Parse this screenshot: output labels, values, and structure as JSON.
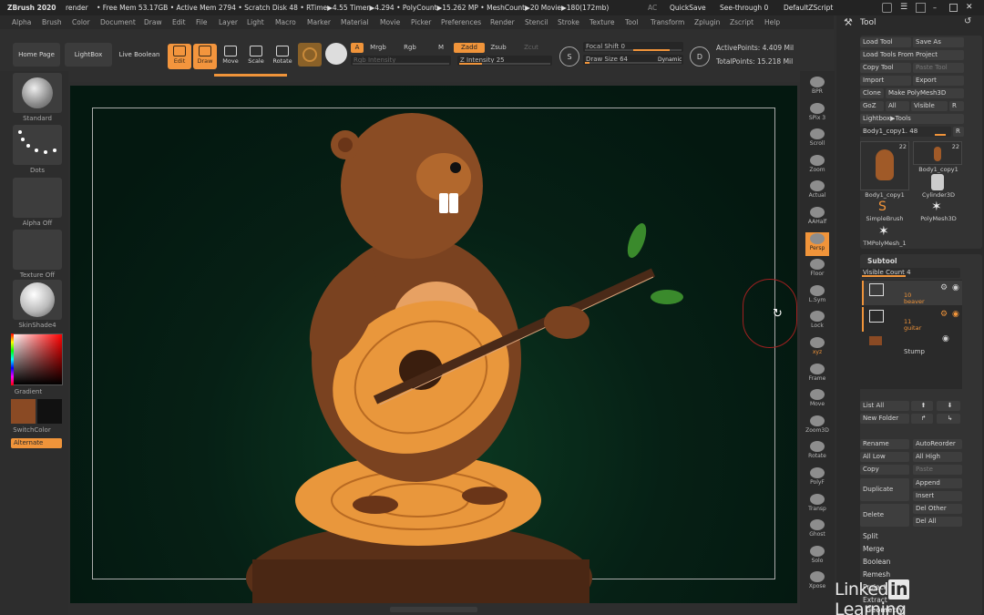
{
  "titlebar": {
    "app": "ZBrush 2020",
    "doc": "render",
    "status": "• Free Mem 53.17GB • Active Mem 2794 • Scratch Disk 48 • RTime▶4.55 Timer▶4.294 • PolyCount▶15.262 MP • MeshCount▶20  Movie▶180(172mb)",
    "ac": "AC",
    "quicksave": "QuickSave",
    "see_through": "See-through  0",
    "default_script": "DefaultZScript"
  },
  "menu": [
    "Alpha",
    "Brush",
    "Color",
    "Document",
    "Draw",
    "Edit",
    "File",
    "Layer",
    "Light",
    "Macro",
    "Marker",
    "Material",
    "Movie",
    "Picker",
    "Preferences",
    "Render",
    "Stencil",
    "Stroke",
    "Texture",
    "Tool",
    "Transform",
    "Zplugin",
    "Zscript",
    "Help"
  ],
  "shelf": {
    "home_page": "Home Page",
    "lightbox": "LightBox",
    "live_boolean": "Live Boolean",
    "edit": "Edit",
    "draw": "Draw",
    "move": "Move",
    "scale": "Scale",
    "rotate": "Rotate",
    "a": "A",
    "mrgb": "Mrgb",
    "rgb": "Rgb",
    "m": "M",
    "rgb_intensity": "Rgb Intensity",
    "zadd": "Zadd",
    "zsub": "Zsub",
    "zcut": "Zcut",
    "z_intensity": "Z Intensity 25",
    "z_intensity_level": 0.25,
    "focal_shift": "Focal Shift  0",
    "draw_size": "Draw Size  64",
    "draw_size_level": 0.05,
    "dynamic": "Dynamic",
    "active_points": "ActivePoints: 4.409 Mil",
    "total_points": "TotalPoints: 15.218 Mil",
    "s_label": "S",
    "d_label": "D"
  },
  "left": {
    "standard": "Standard",
    "dots": "Dots",
    "alpha_off": "Alpha Off",
    "texture_off": "Texture Off",
    "material": "SkinShade4",
    "gradient": "Gradient",
    "switch_color": "SwitchColor",
    "alternate": "Alternate"
  },
  "right_tray": [
    "BPR",
    "SPix 3",
    "Scroll",
    "Zoom",
    "Actual",
    "AAHalf",
    "Persp",
    "Floor",
    "L.Sym",
    "Lock",
    "xyz",
    "Frame",
    "Move",
    "Zoom3D",
    "Rotate",
    "PolyF",
    "Transp",
    "Ghost",
    "Solo",
    "Xpose"
  ],
  "tool_panel": {
    "title": "Tool",
    "load_tool": "Load Tool",
    "save_as": "Save As",
    "load_from_project": "Load Tools From Project",
    "copy_tool": "Copy Tool",
    "paste_tool": "Paste Tool",
    "import": "Import",
    "export": "Export",
    "clone": "Clone",
    "make_polymesh": "Make PolyMesh3D",
    "goz": "GoZ",
    "all": "All",
    "visible": "Visible",
    "r": "R",
    "lightbox_tools": "Lightbox▶Tools",
    "current_tool": "Body1_copy1. 48",
    "r2": "R",
    "thumbs": [
      {
        "name": "Body1_copy1",
        "count": "22"
      },
      {
        "name": "Body1_copy1",
        "count": "22"
      },
      {
        "name": "Cylinder3D",
        "count": ""
      },
      {
        "name": "SimpleBrush",
        "count": ""
      },
      {
        "name": "PolyMesh3D",
        "count": ""
      },
      {
        "name": "TMPolyMesh_1",
        "count": ""
      }
    ],
    "subtool": "Subtool",
    "visible_count": "Visible Count 4",
    "subtools": [
      {
        "num": "10",
        "name": "beaver"
      },
      {
        "num": "11",
        "name": "guitar"
      },
      {
        "num": "",
        "name": "Stump"
      }
    ],
    "list_all": "List All",
    "new_folder": "New Folder",
    "rename": "Rename",
    "auto_reorder": "AutoReorder",
    "all_low": "All Low",
    "all_high": "All High",
    "copy": "Copy",
    "paste": "Paste",
    "duplicate": "Duplicate",
    "append": "Append",
    "insert": "Insert",
    "delete": "Delete",
    "del_other": "Del Other",
    "del_all": "Del All",
    "split": "Split",
    "merge": "Merge",
    "boolean": "Boolean",
    "remesh": "Remesh",
    "project": "Project",
    "extract": "Extract",
    "geometry": "Geometry"
  },
  "watermark": {
    "a": "Linked",
    "b": "in",
    "c": " Learning"
  },
  "colors": {
    "accent": "#f0943a",
    "canvas": "#062015",
    "panel": "#2a2a2a"
  }
}
